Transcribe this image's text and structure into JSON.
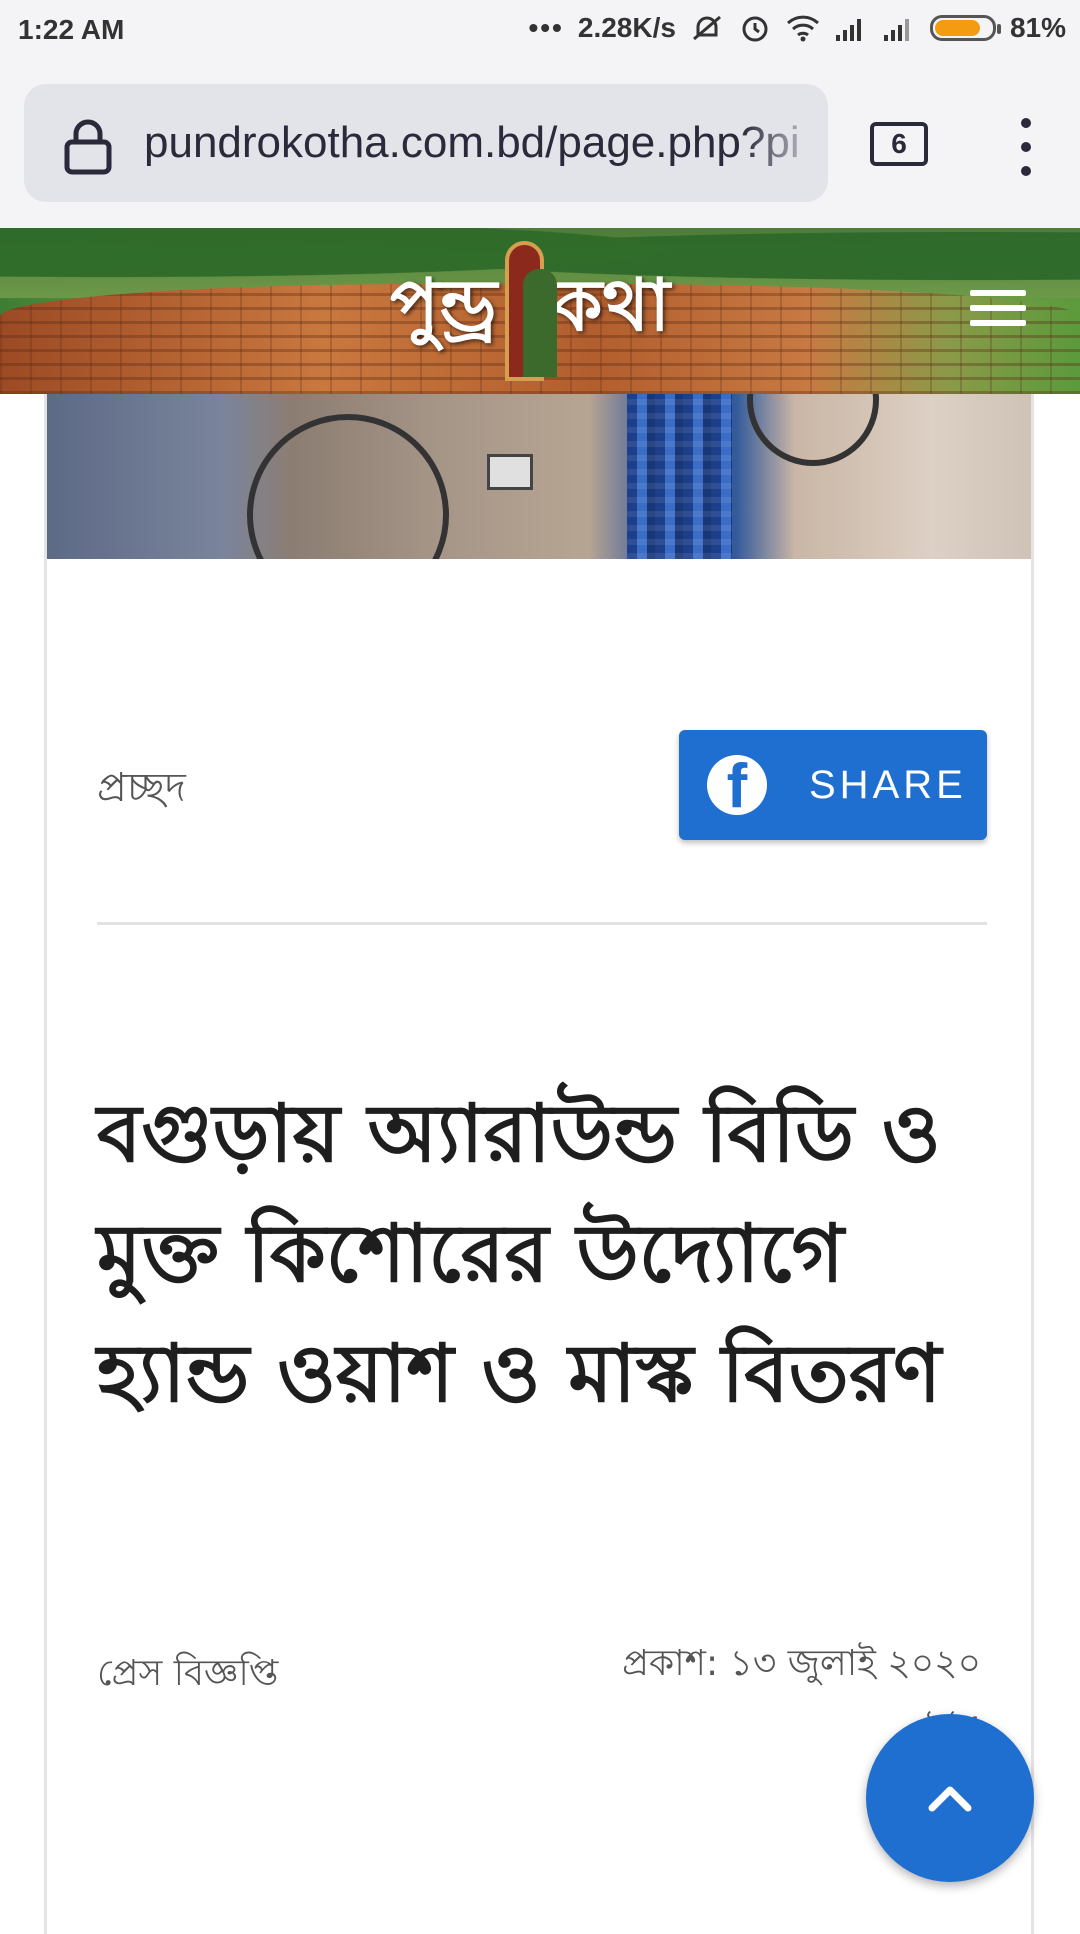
{
  "status_bar": {
    "time": "1:22 AM",
    "network_speed": "2.28K/s",
    "battery_percent": "81%",
    "battery_level": 0.81,
    "icons": [
      "dots-icon",
      "mute-vibrate-icon",
      "alarm-icon",
      "wifi-icon",
      "signal-icon",
      "signal-icon",
      "battery-icon"
    ]
  },
  "browser": {
    "url": "pundrokotha.com.bd/page.php?pi",
    "tab_count": "6"
  },
  "site": {
    "logo_left": "পুন্ড্র",
    "logo_right": "কথা"
  },
  "article": {
    "category": "প্রচ্ছদ",
    "share_label": "SHARE",
    "headline": "বগুড়ায় অ্যারাউন্ড বিডি ও মুক্ত কিশোরের উদ্যোগে হ্যান্ড ওয়াশ ও মাস্ক বিতরণ",
    "author": "প্রেস বিজ্ঞপ্তি",
    "published_line1": "প্রকাশ: ১৩ জুলাই ২০২০",
    "published_line2": "১১:"
  },
  "colors": {
    "accent": "#1f6fd1",
    "battery": "#f39c12"
  }
}
